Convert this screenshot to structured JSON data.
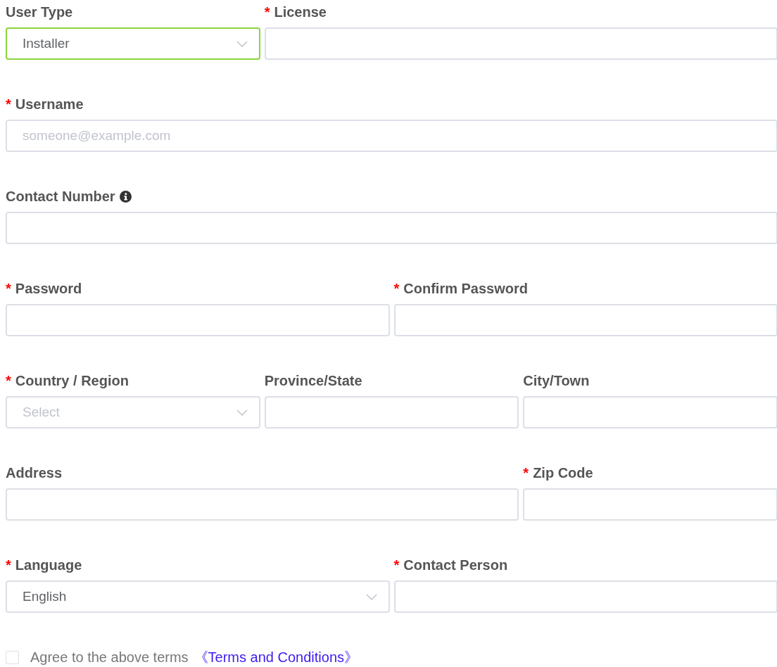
{
  "rows": [
    {
      "fields": [
        {
          "kind": "select",
          "label": "User Type",
          "required": false,
          "value": "Installer",
          "focused": true
        },
        {
          "kind": "input",
          "label": "License",
          "required": true,
          "focused": false
        }
      ]
    },
    {
      "fields": [
        {
          "kind": "input",
          "label": "Username",
          "required": true,
          "placeholder": "someone@example.com",
          "focused": false
        }
      ]
    },
    {
      "fields": [
        {
          "kind": "input",
          "label": "Contact Number",
          "required": false,
          "info": true,
          "focused": false
        }
      ]
    },
    {
      "fields": [
        {
          "kind": "input",
          "label": "Password",
          "required": true,
          "focused": false
        },
        {
          "kind": "input",
          "label": "Confirm Password",
          "required": true,
          "focused": false
        }
      ]
    },
    {
      "fields": [
        {
          "kind": "select",
          "label": "Country / Region",
          "required": true,
          "placeholder": "Select",
          "focused": false
        },
        {
          "kind": "input",
          "label": "Province/State",
          "required": false,
          "focused": false
        },
        {
          "kind": "input",
          "label": "City/Town",
          "required": false,
          "focused": false
        }
      ]
    },
    {
      "fields": [
        {
          "kind": "input",
          "label": "Address",
          "required": false,
          "focused": false
        },
        {
          "kind": "input",
          "label": "Zip Code",
          "required": true,
          "focused": false
        }
      ]
    },
    {
      "fields": [
        {
          "kind": "select",
          "label": "Language",
          "required": true,
          "value": "English",
          "focused": false
        },
        {
          "kind": "input",
          "label": "Contact Person",
          "required": true,
          "focused": false
        }
      ]
    }
  ],
  "required_mark": "*",
  "agree": {
    "checked": false,
    "text": "Agree to the above terms",
    "link": "《Terms and Conditions》"
  }
}
